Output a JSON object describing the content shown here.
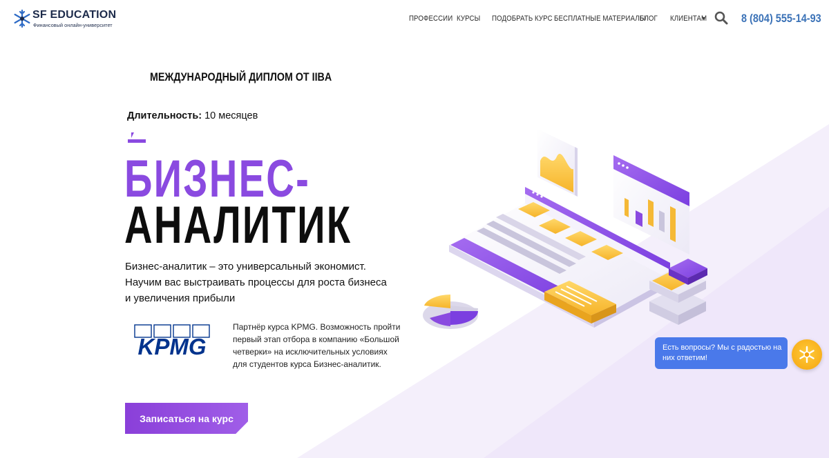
{
  "header": {
    "logo": {
      "name": "SF EDUCATION",
      "tagline": "Финансовый онлайн-университет"
    },
    "nav": [
      {
        "label": "ПРОФЕССИИ"
      },
      {
        "label": "КУРСЫ"
      },
      {
        "label": "ПОДОБРАТЬ КУРС"
      },
      {
        "label": "БЕСПЛАТНЫЕ МАТЕРИАЛЫ"
      },
      {
        "label": "БЛОГ"
      },
      {
        "label": "КЛИЕНТАМ",
        "icon": "caret-down-icon"
      }
    ],
    "search_icon": "search-icon",
    "phone": "8 (804) 555-14-93"
  },
  "hero": {
    "diploma": "МЕЖДУНАРОДНЫЙ ДИПЛОМ ОТ IIBA",
    "duration_label": "Длительность:",
    "duration_value": "10 месяцев",
    "title_line1": "БИЗНЕС-",
    "title_line2": "АНАЛИТИК",
    "description": [
      "Бизнес-аналитик – это универсальный экономист.",
      "Научим вас выстраивать процессы для роста бизнеса",
      "и увеличения прибыли"
    ],
    "partner_logo_text": "KPMG",
    "partner_text": [
      "Партнёр курса KPMG. Возможность пройти",
      "первый этап отбора в компанию «Большой",
      "четверки» на исключительных условиях",
      "для студентов курса Бизнес-аналитик."
    ],
    "cta_label": "Записаться на курс"
  },
  "chat": {
    "message": [
      "Есть вопросы? Мы с радостью на",
      "них ответим!"
    ],
    "icon": "chat-logo-icon"
  },
  "colors": {
    "accent_purple": "#8a4ae0",
    "phone_blue": "#3b72b7",
    "chat_blue": "#4a79ea",
    "chat_yellow": "#f5a40e",
    "kpmg_blue": "#00338d"
  }
}
